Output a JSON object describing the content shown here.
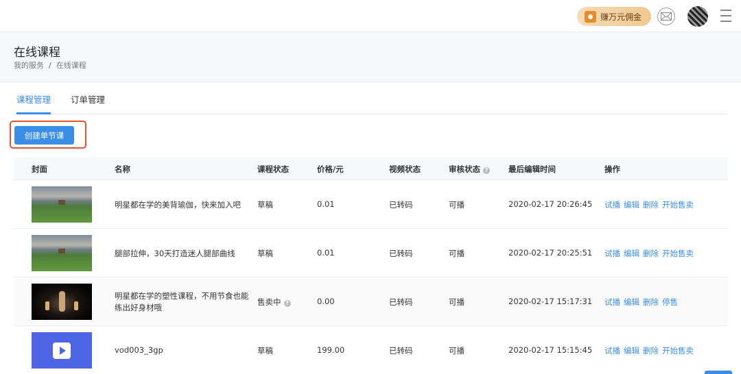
{
  "topbar": {
    "promo_label": "赚万元佣金",
    "mail_icon": "mail-icon",
    "avatar_icon": "qr-avatar",
    "menu_icon": "hamburger-menu-icon"
  },
  "header": {
    "title": "在线课程",
    "breadcrumb": [
      "我的服务",
      "在线课程"
    ],
    "breadcrumb_sep": "/"
  },
  "tabs": [
    {
      "label": "课程管理",
      "active": true
    },
    {
      "label": "订单管理",
      "active": false
    }
  ],
  "create_button": "创建单节课",
  "table": {
    "columns": [
      "封面",
      "名称",
      "课程状态",
      "价格/元",
      "视频状态",
      "审核状态",
      "最后编辑时间",
      "操作"
    ],
    "help_glyph": "?",
    "rows": [
      {
        "cover": "landscape",
        "name": "明星都在学的美背瑜伽，快来加入吧",
        "status": "草稿",
        "status_help": false,
        "price": "0.01",
        "video_status": "已转码",
        "review_status": "可播",
        "edited": "2020-02-17 20:26:45",
        "actions": [
          "试播",
          "编辑",
          "删除",
          "开始售卖"
        ]
      },
      {
        "cover": "landscape",
        "name": "腿部拉伸，30天打造迷人腿部曲线",
        "status": "草稿",
        "status_help": false,
        "price": "0.01",
        "video_status": "已转码",
        "review_status": "可播",
        "edited": "2020-02-17 20:25:51",
        "actions": [
          "试播",
          "编辑",
          "删除",
          "开始售卖"
        ]
      },
      {
        "cover": "stage",
        "name": "明星都在学的塑性课程，不用节食也能练出好身材哦",
        "status": "售卖中",
        "status_help": true,
        "price": "0.00",
        "video_status": "已转码",
        "review_status": "可播",
        "edited": "2020-02-17 15:17:31",
        "actions": [
          "试播",
          "编辑",
          "删除",
          "停售"
        ]
      },
      {
        "cover": "video",
        "name": "vod003_3gp",
        "status": "草稿",
        "status_help": false,
        "price": "199.00",
        "video_status": "已转码",
        "review_status": "可播",
        "edited": "2020-02-17 15:15:45",
        "actions": [
          "试播",
          "编辑",
          "删除",
          "开始售卖"
        ]
      }
    ]
  },
  "colors": {
    "accent": "#3a8ee6",
    "highlight_border": "#e2532d",
    "promo": "#f0c98f"
  }
}
